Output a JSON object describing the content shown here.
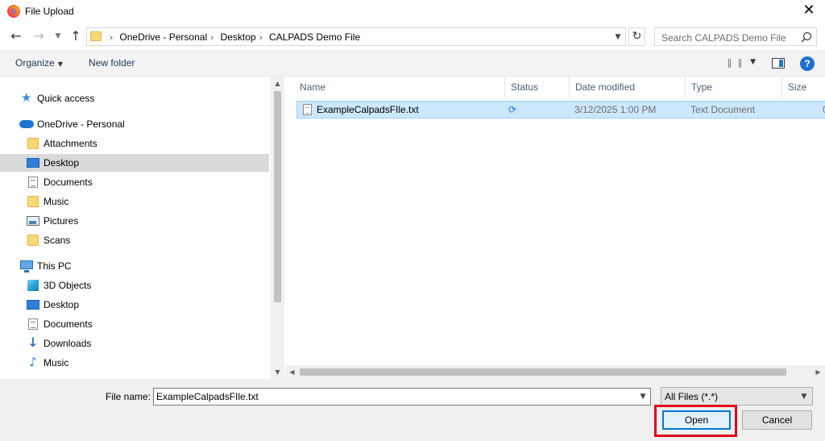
{
  "window": {
    "title": "File Upload"
  },
  "address": {
    "crumbs": [
      "OneDrive - Personal",
      "Desktop",
      "CALPADS Demo File"
    ],
    "search_placeholder": "Search CALPADS Demo File"
  },
  "toolbar": {
    "organize_label": "Organize",
    "new_folder_label": "New folder"
  },
  "sidebar": {
    "items": [
      {
        "label": "Quick access",
        "icon": "star-icon"
      },
      {
        "label": "OneDrive - Personal",
        "icon": "cloud-icon"
      },
      {
        "label": "Attachments",
        "icon": "folder-icon"
      },
      {
        "label": "Desktop",
        "icon": "desktop-icon",
        "selected": true
      },
      {
        "label": "Documents",
        "icon": "document-icon"
      },
      {
        "label": "Music",
        "icon": "folder-icon"
      },
      {
        "label": "Pictures",
        "icon": "pictures-icon"
      },
      {
        "label": "Scans",
        "icon": "folder-icon"
      },
      {
        "label": "This PC",
        "icon": "computer-icon"
      },
      {
        "label": "3D Objects",
        "icon": "cube-icon"
      },
      {
        "label": "Desktop",
        "icon": "desktop-icon"
      },
      {
        "label": "Documents",
        "icon": "document-icon"
      },
      {
        "label": "Downloads",
        "icon": "download-icon"
      },
      {
        "label": "Music",
        "icon": "music-icon"
      }
    ]
  },
  "file_list": {
    "columns": [
      "Name",
      "Status",
      "Date modified",
      "Type",
      "Size"
    ],
    "rows": [
      {
        "name": "ExampleCalpadsFIle.txt",
        "status_icon": "sync-icon",
        "date_modified": "3/12/2025 1:00 PM",
        "type": "Text Document",
        "size": "0"
      }
    ]
  },
  "footer": {
    "file_name_label": "File name:",
    "file_name_value": "ExampleCalpadsFIle.txt",
    "file_type_value": "All Files (*.*)",
    "open_label": "Open",
    "cancel_label": "Cancel"
  },
  "colors": {
    "selection": "#cce8ff",
    "accent": "#0078d7",
    "highlight_border": "#e0001b"
  }
}
